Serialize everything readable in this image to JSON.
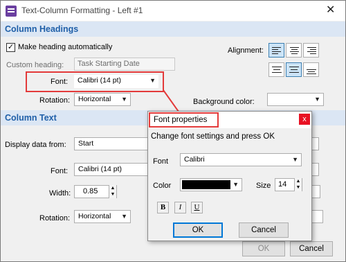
{
  "window": {
    "title": "Text-Column Formatting - Left #1",
    "close_glyph": "✕"
  },
  "column_headings": {
    "section_title": "Column Headings",
    "make_heading_label": "Make heading automatically",
    "make_heading_checked": true,
    "custom_heading_label": "Custom heading:",
    "custom_heading_value": "Task Starting Date",
    "font_label": "Font:",
    "font_value": "Calibri (14 pt)",
    "rotation_label": "Rotation:",
    "rotation_value": "Horizontal",
    "alignment_label": "Alignment:",
    "background_color_label": "Background color:",
    "background_color_value": ""
  },
  "column_text": {
    "section_title": "Column Text",
    "display_from_label": "Display data from:",
    "display_from_value": "Start",
    "font_label": "Font:",
    "font_value": "Calibri (14 pt)",
    "width_label": "Width:",
    "width_value": "0.85",
    "rotation_label": "Rotation:",
    "rotation_value": "Horizontal"
  },
  "footer": {
    "ok_label": "OK",
    "cancel_label": "Cancel"
  },
  "font_dialog": {
    "title": "Font properties",
    "close_glyph": "x",
    "instruction": "Change font settings and press OK",
    "font_label": "Font",
    "font_value": "Calibri",
    "color_label": "Color",
    "color_value": "#000000",
    "size_label": "Size",
    "size_value": "14",
    "bold_label": "B",
    "italic_label": "I",
    "underline_label": "U",
    "ok_label": "OK",
    "cancel_label": "Cancel"
  },
  "icons": {
    "dropdown_arrow": "▼",
    "spin_up": "▲",
    "spin_down": "▼",
    "checkmark": "✓"
  },
  "colors": {
    "highlight": "#e33a3a",
    "section_text": "#1f5fa8",
    "accent": "#0078d7"
  }
}
